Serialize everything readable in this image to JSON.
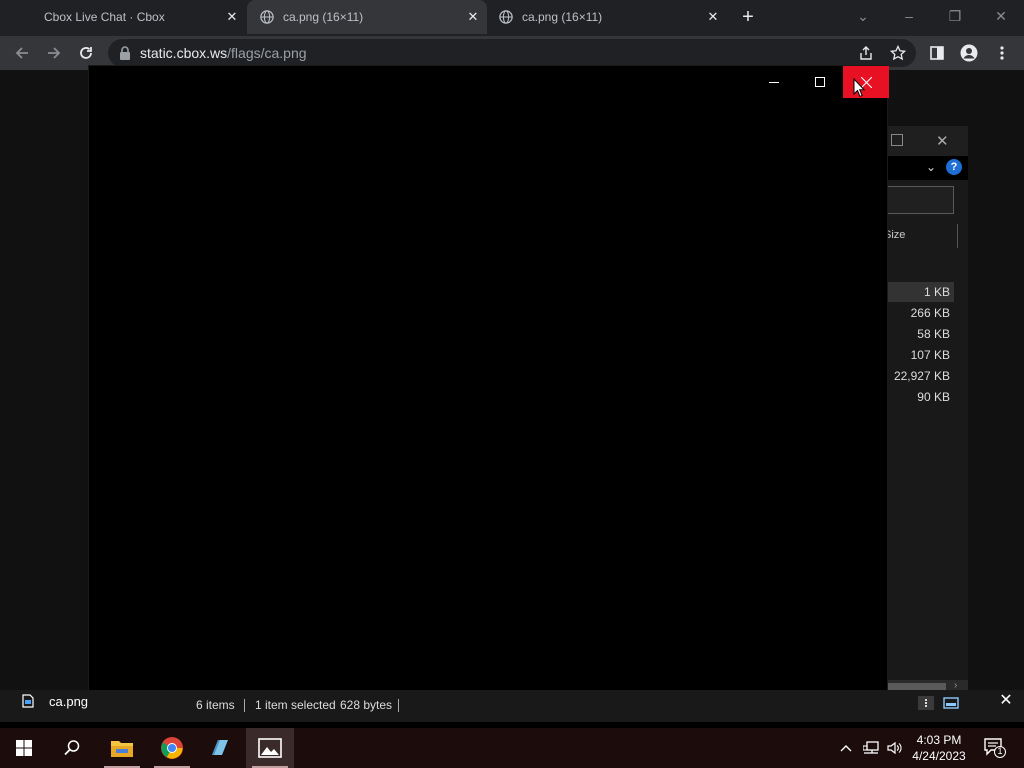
{
  "browser": {
    "tabs": [
      {
        "title": "Cbox Live Chat · Cbox",
        "active": false
      },
      {
        "title": "ca.png (16×11)",
        "active": true
      },
      {
        "title": "ca.png (16×11)",
        "active": false
      }
    ],
    "url_host": "static.cbox.ws",
    "url_path": "/flags/ca.png"
  },
  "explorer": {
    "column_header": "Size",
    "sizes": [
      "1 KB",
      "266 KB",
      "58 KB",
      "107 KB",
      "22,927 KB",
      "90 KB"
    ],
    "help_label": "?"
  },
  "viewer": {
    "file_name": "ca.png"
  },
  "status": {
    "items_count": "6 items",
    "selection": "1 item selected",
    "selection_size": "628 bytes"
  },
  "clock": {
    "time": "4:03 PM",
    "date": "4/24/2023"
  },
  "notifications": {
    "count": "1"
  },
  "colors": {
    "close_hover": "#e81123",
    "browser_bg": "#202124",
    "toolbar_bg": "#35363a",
    "taskbar_bg": "#1c0c0c",
    "help_blue": "#1f6ed6"
  }
}
